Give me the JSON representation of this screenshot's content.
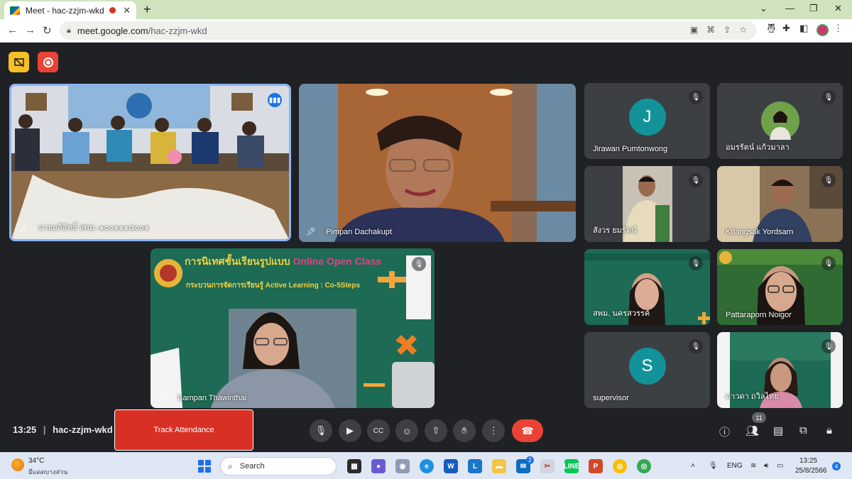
{
  "browser": {
    "tab_title": "Meet - hac-zzjm-wkd",
    "new_tab": "+",
    "url_host": "meet.google.com",
    "url_path": "/hac-zzjm-wkd"
  },
  "meeting": {
    "time": "13:25",
    "code": "hac-zzjm-wkd",
    "track_attendance": "Track Attendance",
    "participant_count": "11"
  },
  "tiles": {
    "room": {
      "name": "นายอภิสิทธิ์ สพม.-๑๐๐๑๑๑๘๐๐๑"
    },
    "pimpan": {
      "name": "Pimpan Dachakupt"
    },
    "sampan": {
      "name": "Sampan Thawinthai"
    },
    "jirawan": {
      "name": "Jirawan Pumtonwong",
      "initial": "J"
    },
    "amornrat": {
      "name": "อมรรัตน์ แก้วมาลา"
    },
    "sangwon": {
      "name": "สังวร ยมรัตน์"
    },
    "kriangsak": {
      "name": "Kriangsak Yordsarn"
    },
    "spm": {
      "name": "สพม. นครสวรรค์"
    },
    "pattaraporn": {
      "name": "Pattaraporn Noigor"
    },
    "supervisor": {
      "name": "supervisor",
      "initial": "S"
    },
    "dao": {
      "name": "ดาวดา ถวิลไทย"
    }
  },
  "slide": {
    "title_th": "การนิเทศชั้นเรียนรูปแบบ",
    "title_en": "Online Open Class",
    "subtitle": "กระบวนการจัดการเรียนรู้ Active Learning : Co-5Steps"
  },
  "taskbar": {
    "temp": "34°C",
    "weather": "มีแดดบางส่วน",
    "search": "Search",
    "lang": "ENG",
    "time": "13:25",
    "date": "25/8/2566",
    "mail_badge": "2",
    "notifications": "4"
  },
  "colors": {
    "accent_blue": "#8ab4f8",
    "hangup_red": "#ea4335",
    "track_red": "#d93025",
    "avatar_teal": "#12939a"
  }
}
